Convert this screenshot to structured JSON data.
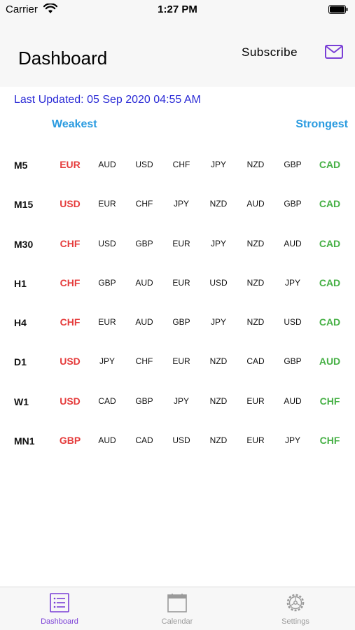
{
  "status_bar": {
    "carrier": "Carrier",
    "time": "1:27 PM"
  },
  "header": {
    "title": "Dashboard",
    "subscribe_label": "Subscribe"
  },
  "last_updated": "Last Updated: 05 Sep 2020 04:55 AM",
  "scale": {
    "weakest": "Weakest",
    "strongest": "Strongest"
  },
  "rows": [
    {
      "tf": "M5",
      "cur": [
        "EUR",
        "AUD",
        "USD",
        "CHF",
        "JPY",
        "NZD",
        "GBP",
        "CAD"
      ]
    },
    {
      "tf": "M15",
      "cur": [
        "USD",
        "EUR",
        "CHF",
        "JPY",
        "NZD",
        "AUD",
        "GBP",
        "CAD"
      ]
    },
    {
      "tf": "M30",
      "cur": [
        "CHF",
        "USD",
        "GBP",
        "EUR",
        "JPY",
        "NZD",
        "AUD",
        "CAD"
      ]
    },
    {
      "tf": "H1",
      "cur": [
        "CHF",
        "GBP",
        "AUD",
        "EUR",
        "USD",
        "NZD",
        "JPY",
        "CAD"
      ]
    },
    {
      "tf": "H4",
      "cur": [
        "CHF",
        "EUR",
        "AUD",
        "GBP",
        "JPY",
        "NZD",
        "USD",
        "CAD"
      ]
    },
    {
      "tf": "D1",
      "cur": [
        "USD",
        "JPY",
        "CHF",
        "EUR",
        "NZD",
        "CAD",
        "GBP",
        "AUD"
      ]
    },
    {
      "tf": "W1",
      "cur": [
        "USD",
        "CAD",
        "GBP",
        "JPY",
        "NZD",
        "EUR",
        "AUD",
        "CHF"
      ]
    },
    {
      "tf": "MN1",
      "cur": [
        "GBP",
        "AUD",
        "CAD",
        "USD",
        "NZD",
        "EUR",
        "JPY",
        "CHF"
      ]
    }
  ],
  "tabs": [
    {
      "label": "Dashboard",
      "icon": "list-icon",
      "active": true
    },
    {
      "label": "Calendar",
      "icon": "calendar-icon",
      "active": false
    },
    {
      "label": "Settings",
      "icon": "gear-icon",
      "active": false
    }
  ],
  "colors": {
    "accent": "#7a3fd6",
    "weak": "#e53c3c",
    "strong": "#46b045",
    "scale_label": "#2a9be0",
    "updated_text": "#2b2bd6"
  }
}
